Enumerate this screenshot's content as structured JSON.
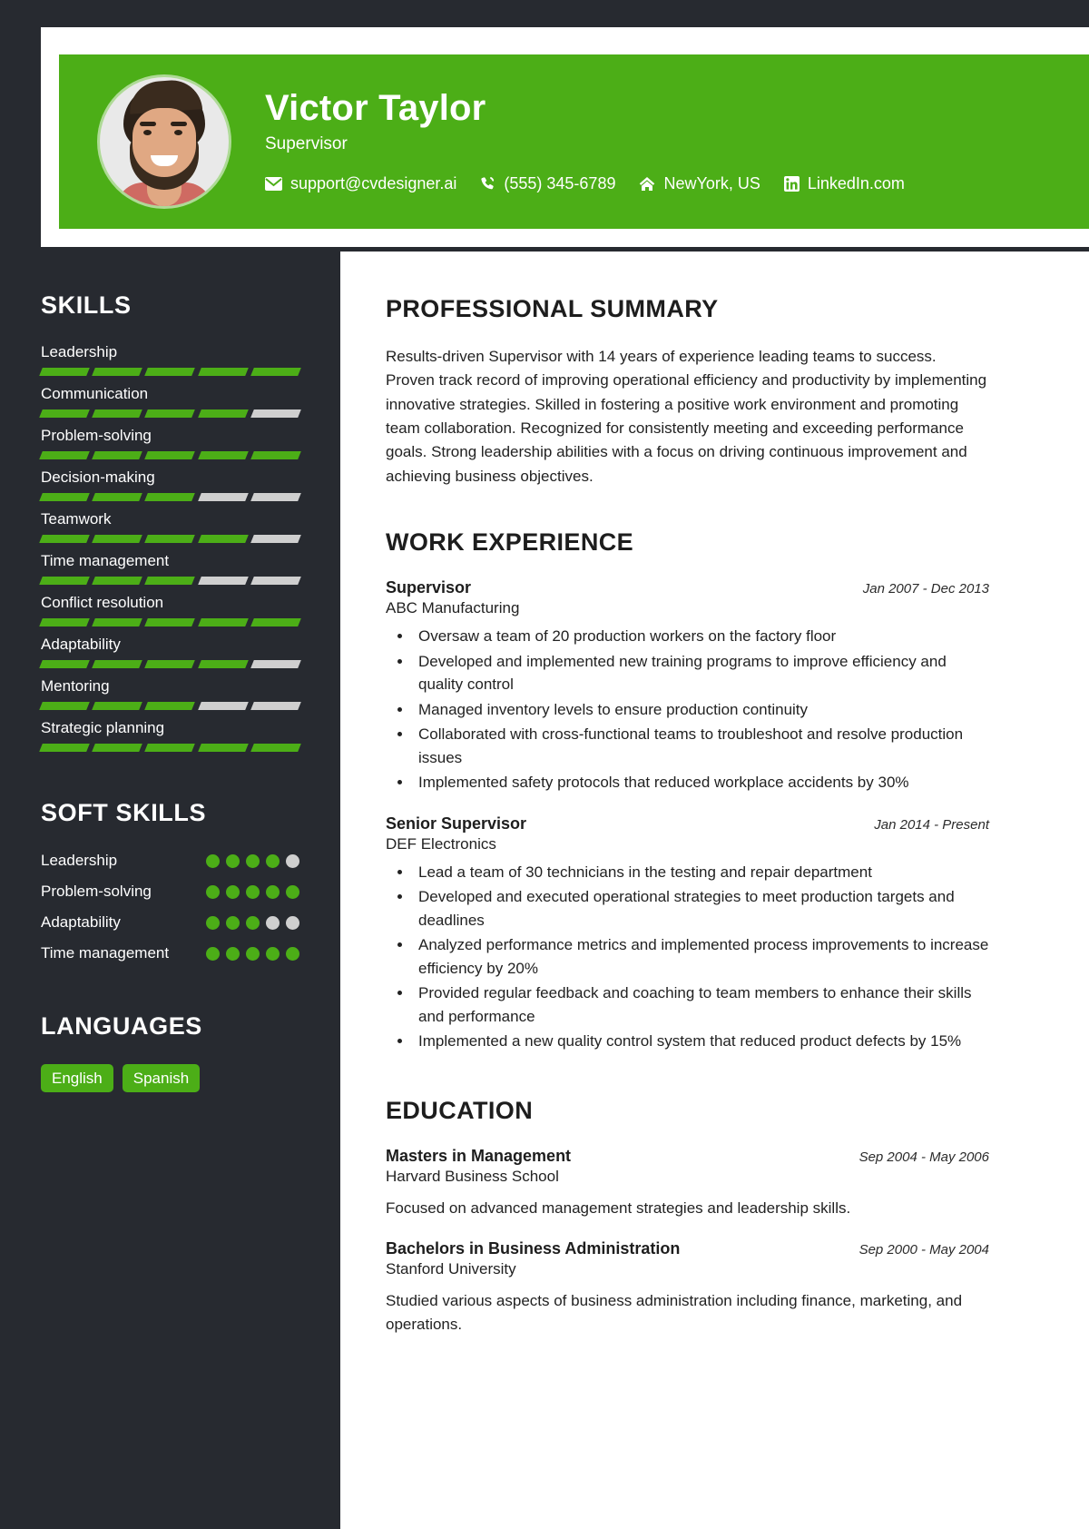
{
  "header": {
    "name": "Victor Taylor",
    "role": "Supervisor",
    "accent_color": "#4CAE17",
    "contacts": [
      {
        "icon": "envelope-icon",
        "text": "support@cvdesigner.ai"
      },
      {
        "icon": "phone-icon",
        "text": "(555) 345-6789"
      },
      {
        "icon": "home-icon",
        "text": "NewYork, US"
      },
      {
        "icon": "linkedin-icon",
        "text": "LinkedIn.com"
      }
    ]
  },
  "sidebar": {
    "skills_title": "SKILLS",
    "skills": [
      {
        "label": "Leadership",
        "level": 5
      },
      {
        "label": "Communication",
        "level": 4
      },
      {
        "label": "Problem-solving",
        "level": 5
      },
      {
        "label": "Decision-making",
        "level": 3
      },
      {
        "label": "Teamwork",
        "level": 4
      },
      {
        "label": "Time management",
        "level": 3
      },
      {
        "label": "Conflict resolution",
        "level": 5
      },
      {
        "label": "Adaptability",
        "level": 4
      },
      {
        "label": "Mentoring",
        "level": 3
      },
      {
        "label": "Strategic planning",
        "level": 5
      }
    ],
    "skill_segments": 5,
    "soft_skills_title": "SOFT SKILLS",
    "soft_skills": [
      {
        "label": "Leadership",
        "level": 4
      },
      {
        "label": "Problem-solving",
        "level": 5
      },
      {
        "label": "Adaptability",
        "level": 3
      },
      {
        "label": "Time management",
        "level": 5
      }
    ],
    "soft_skill_dots": 5,
    "languages_title": "LANGUAGES",
    "languages": [
      "English",
      "Spanish"
    ]
  },
  "main": {
    "summary_title": "PROFESSIONAL SUMMARY",
    "summary_text": "Results-driven Supervisor with 14 years of experience leading teams to success. Proven track record of improving operational efficiency and productivity by implementing innovative strategies. Skilled in fostering a positive work environment and promoting team collaboration. Recognized for consistently meeting and exceeding performance goals. Strong leadership abilities with a focus on driving continuous improvement and achieving business objectives.",
    "experience_title": "WORK EXPERIENCE",
    "experience": [
      {
        "title": "Supervisor",
        "company": "ABC Manufacturing",
        "date": "Jan 2007 - Dec 2013",
        "bullets": [
          "Oversaw a team of 20 production workers on the factory floor",
          "Developed and implemented new training programs to improve efficiency and quality control",
          "Managed inventory levels to ensure production continuity",
          "Collaborated with cross-functional teams to troubleshoot and resolve production issues",
          "Implemented safety protocols that reduced workplace accidents by 30%"
        ]
      },
      {
        "title": "Senior Supervisor",
        "company": "DEF Electronics",
        "date": "Jan 2014 - Present",
        "bullets": [
          "Lead a team of 30 technicians in the testing and repair department",
          "Developed and executed operational strategies to meet production targets and deadlines",
          "Analyzed performance metrics and implemented process improvements to increase efficiency by 20%",
          "Provided regular feedback and coaching to team members to enhance their skills and performance",
          "Implemented a new quality control system that reduced product defects by 15%"
        ]
      }
    ],
    "education_title": "EDUCATION",
    "education": [
      {
        "degree": "Masters in Management",
        "school": "Harvard Business School",
        "date": "Sep 2004 - May 2006",
        "description": "Focused on advanced management strategies and leadership skills."
      },
      {
        "degree": "Bachelors in Business Administration",
        "school": "Stanford University",
        "date": "Sep 2000 - May 2004",
        "description": "Studied various aspects of business administration including finance, marketing, and operations."
      }
    ]
  }
}
